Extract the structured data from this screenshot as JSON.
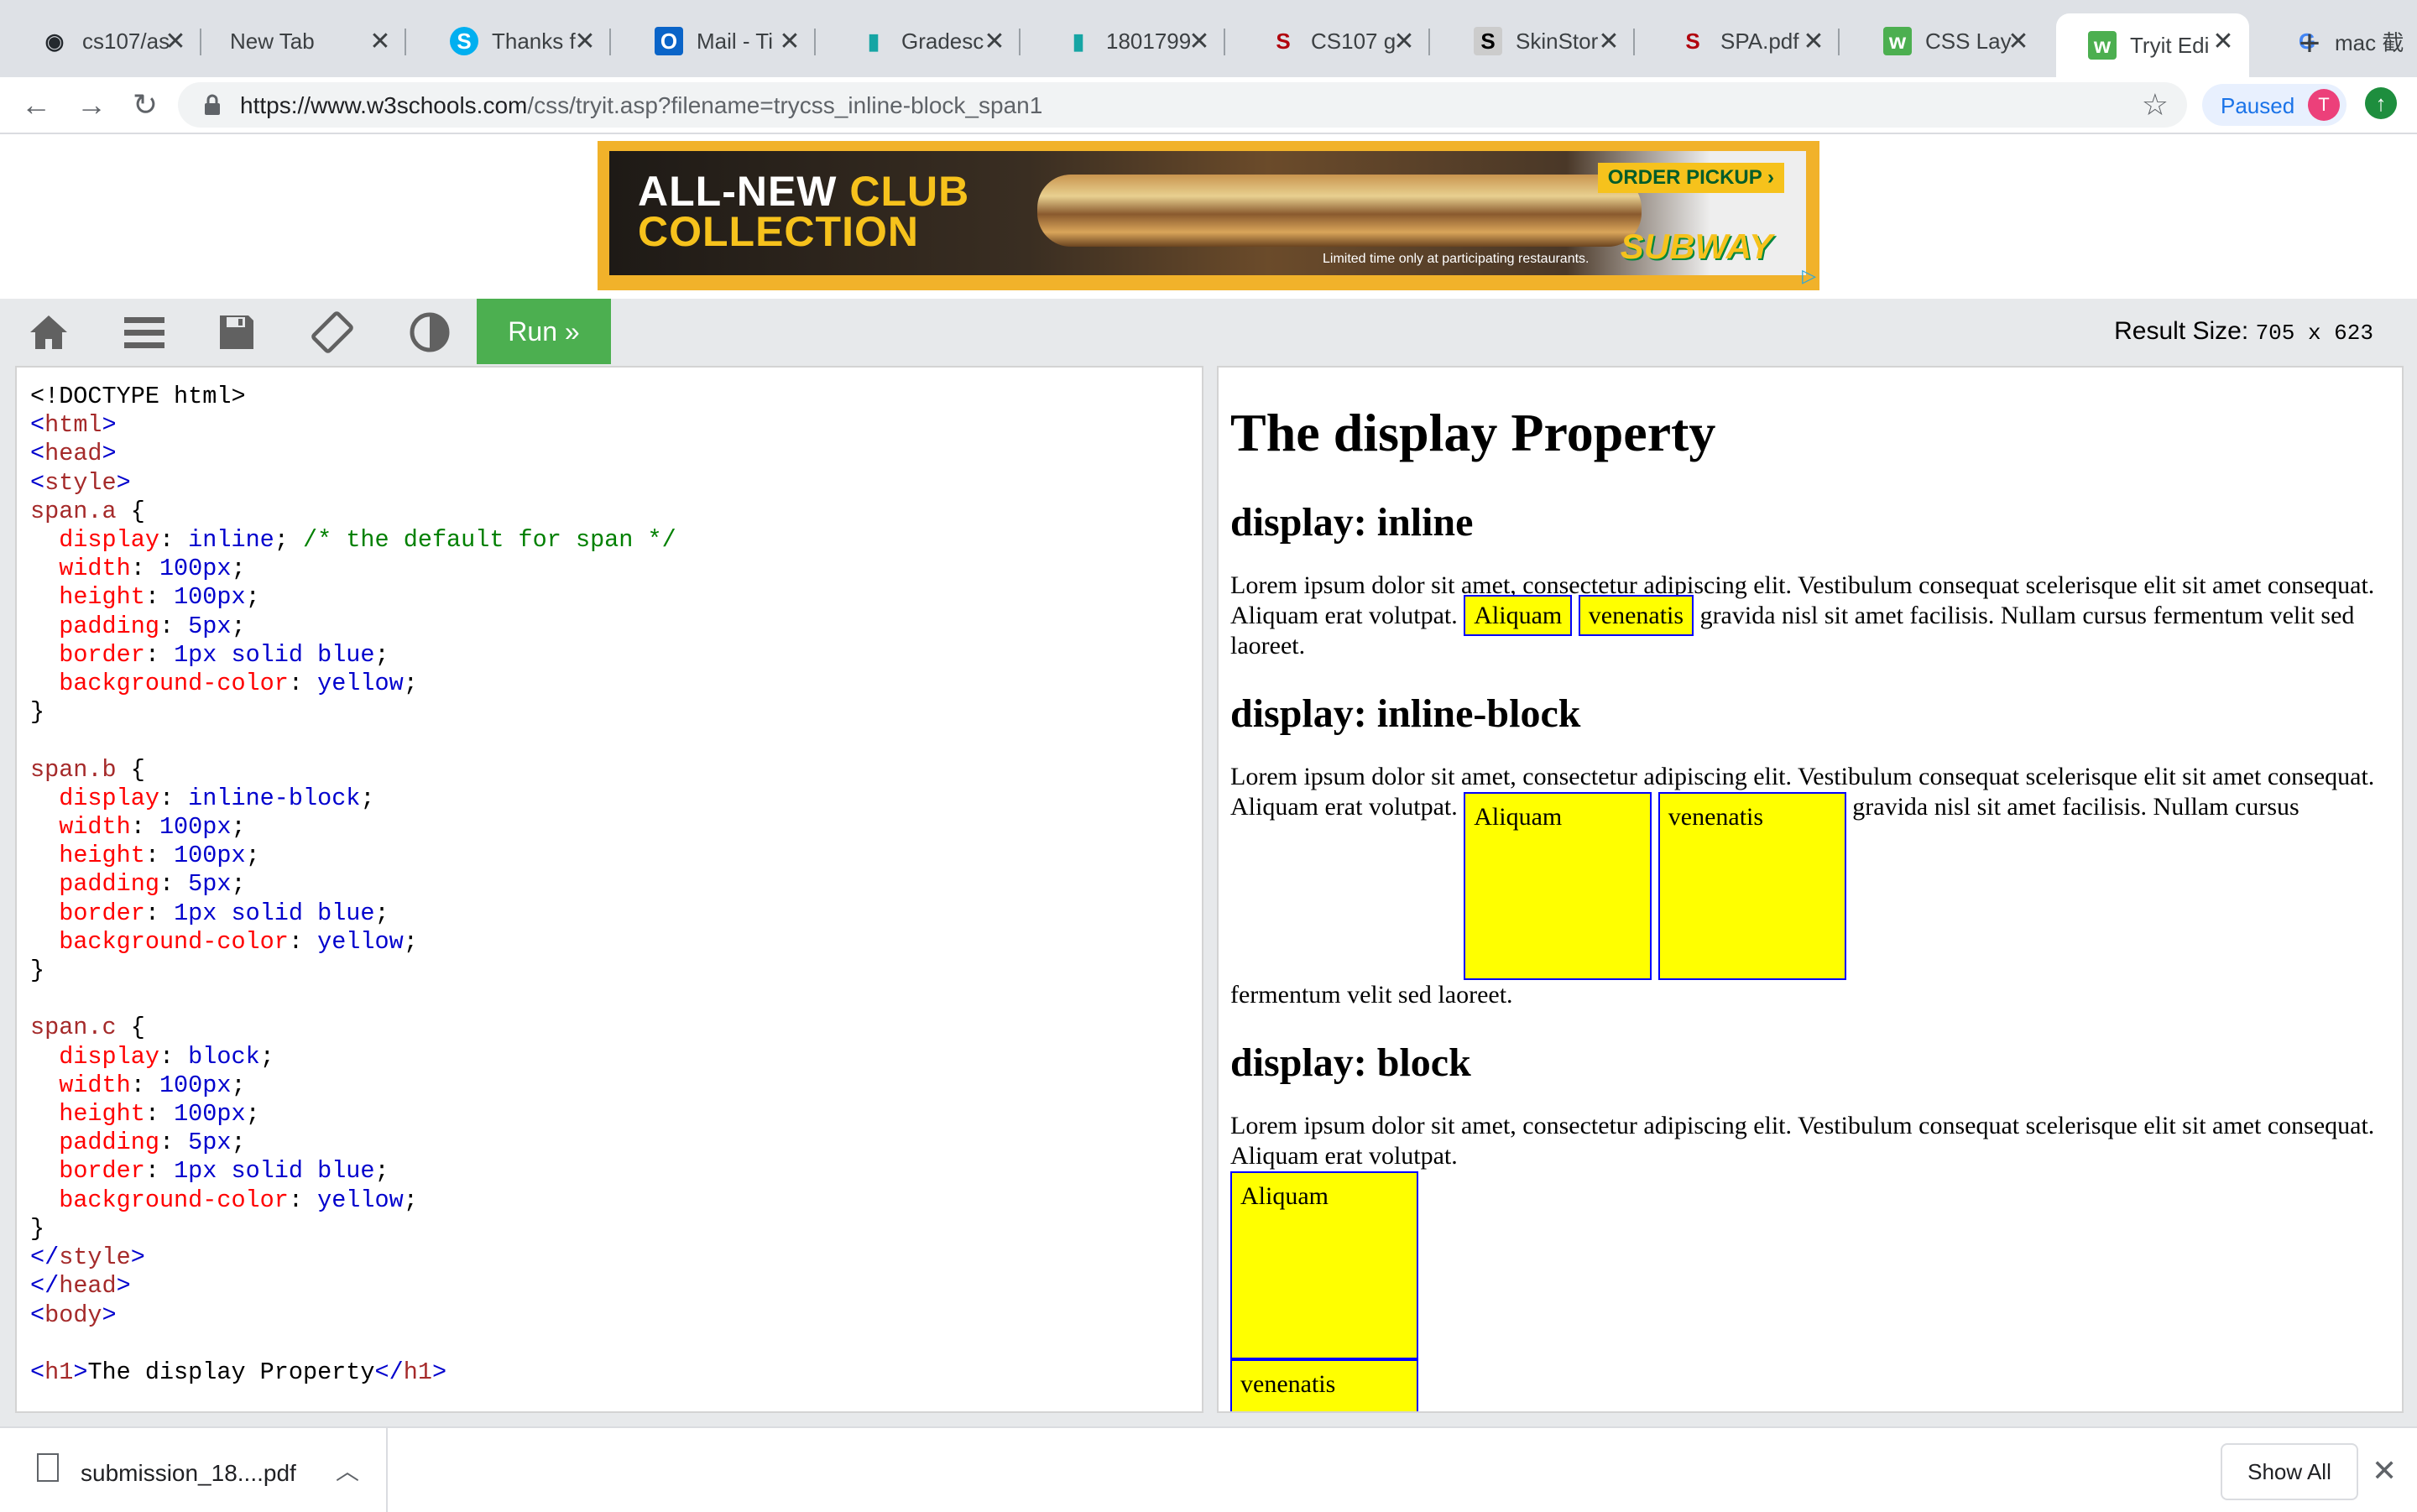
{
  "browser": {
    "tabs": [
      {
        "title": "cs107/as",
        "icon": "github-icon",
        "active": false
      },
      {
        "title": "New Tab",
        "icon": "",
        "active": false
      },
      {
        "title": "Thanks f",
        "icon": "skype-icon",
        "active": false
      },
      {
        "title": "Mail - Ti",
        "icon": "outlook-icon",
        "active": false
      },
      {
        "title": "Gradesc",
        "icon": "bar-chart-icon",
        "active": false
      },
      {
        "title": "1801799",
        "icon": "bar-chart-icon",
        "active": false
      },
      {
        "title": "CS107 g",
        "icon": "stanford-icon",
        "active": false
      },
      {
        "title": "SkinStor",
        "icon": "s-icon",
        "active": false
      },
      {
        "title": "SPA.pdf",
        "icon": "stanford-icon",
        "active": false
      },
      {
        "title": "CSS Lay",
        "icon": "w3schools-icon",
        "active": false
      },
      {
        "title": "Tryit Edi",
        "icon": "w3schools-icon",
        "active": true
      },
      {
        "title": "mac 截",
        "icon": "google-icon",
        "active": false
      }
    ],
    "url_host": "https://www.w3schools.com",
    "url_path": "/css/tryit.asp?filename=trycss_inline-block_span1",
    "profile_status": "Paused",
    "profile_initial": "T"
  },
  "ad": {
    "headline_line1_a": "ALL-NEW ",
    "headline_line1_b": "CLUB",
    "headline_line2": "COLLECTION",
    "cta": "ORDER PICKUP ›",
    "fine_print": "Limited time only at participating restaurants.",
    "brand": "SUBWAY"
  },
  "editor": {
    "run_label": "Run »",
    "result_size_label": "Result Size:",
    "result_size_value": "705 x 623"
  },
  "result": {
    "h1": "The display Property",
    "h2_inline": "display: inline",
    "h2_inline_block": "display: inline-block",
    "h2_block": "display: block",
    "p_lead_1": "Lorem ipsum dolor sit amet, consectetur adipiscing elit. Vestibulum consequat scelerisque elit sit amet consequat. Aliquam erat volutpat. ",
    "span1": "Aliquam",
    "span2": "venenatis",
    "p_mid": " gravida nisl sit amet facilisis.",
    "p_tail": " Nullam cursus fermentum velit sed laoreet.",
    "p_block_lead": "Lorem ipsum dolor sit amet, consectetur adipiscing elit. Vestibulum consequat scelerisque elit sit amet consequat. Aliquam erat volutpat."
  },
  "downloads": {
    "file_name": "submission_18....pdf",
    "show_all": "Show All"
  }
}
